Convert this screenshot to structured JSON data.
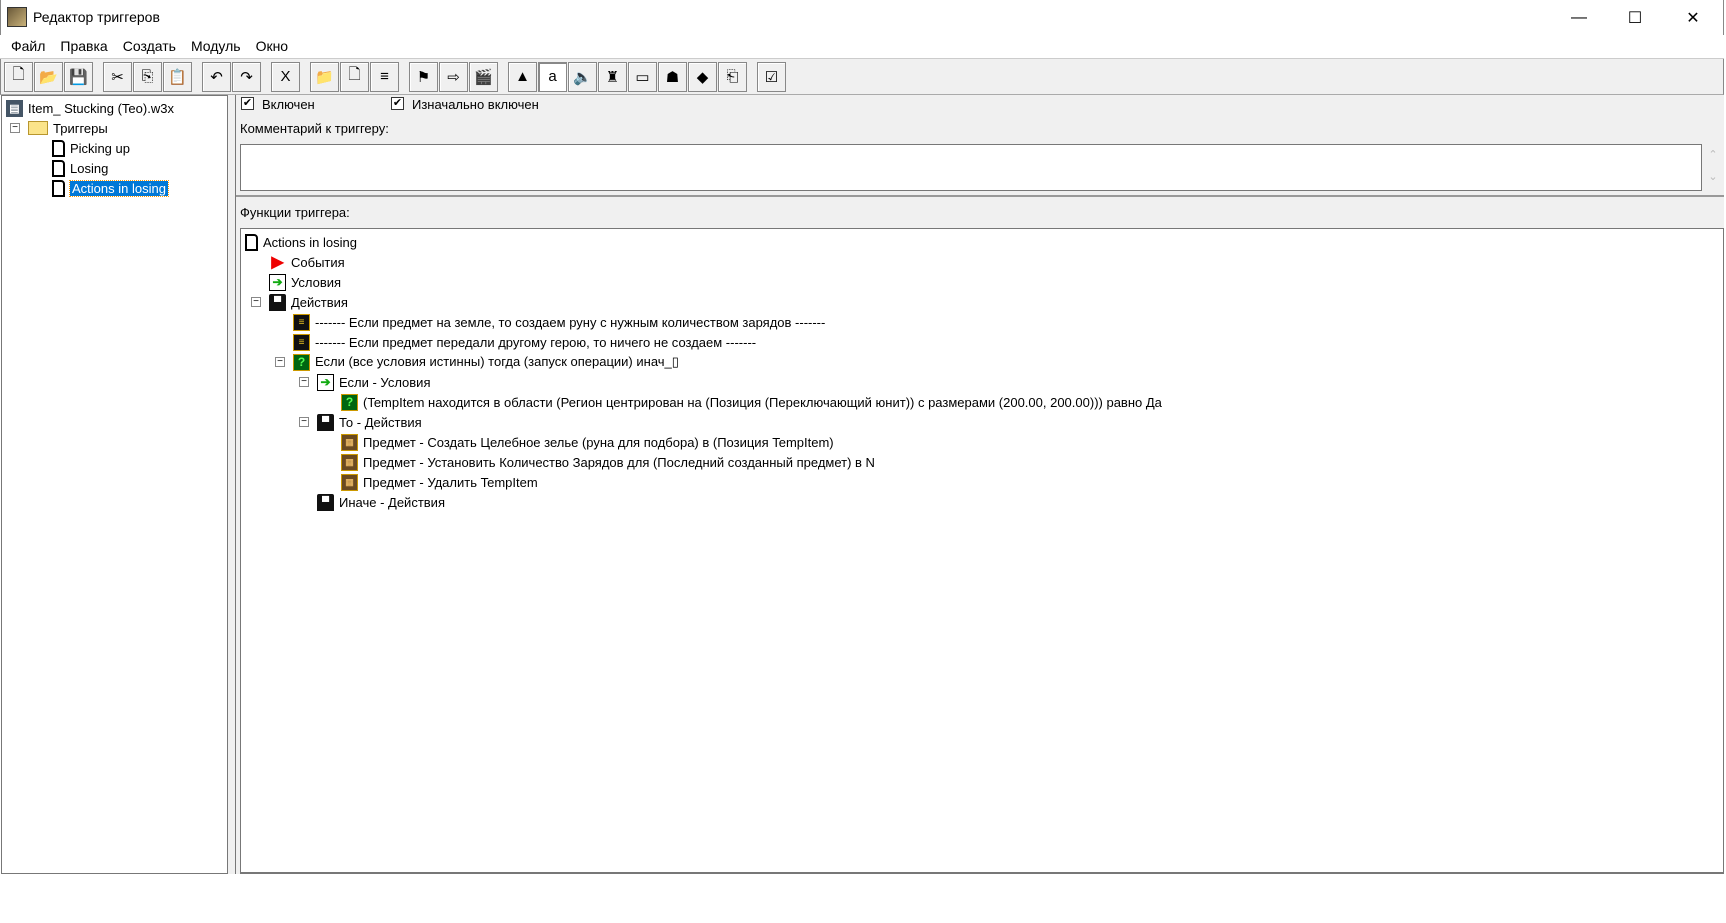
{
  "window": {
    "title": "Редактор триггеров",
    "minimize": "—",
    "maximize": "☐",
    "close": "✕"
  },
  "menu": [
    "Файл",
    "Правка",
    "Создать",
    "Модуль",
    "Окно"
  ],
  "toolbar": [
    {
      "name": "new",
      "glyph": "🗋"
    },
    {
      "name": "open",
      "glyph": "📂"
    },
    {
      "name": "save",
      "glyph": "💾"
    },
    null,
    {
      "name": "cut",
      "glyph": "✂"
    },
    {
      "name": "copy",
      "glyph": "⎘"
    },
    {
      "name": "paste",
      "glyph": "📋"
    },
    null,
    {
      "name": "undo",
      "glyph": "↶"
    },
    {
      "name": "redo",
      "glyph": "↷"
    },
    null,
    {
      "name": "delete",
      "glyph": "X"
    },
    null,
    {
      "name": "new-category",
      "glyph": "📁"
    },
    {
      "name": "new-trigger",
      "glyph": "🗋"
    },
    {
      "name": "new-comment",
      "glyph": "≡"
    },
    null,
    {
      "name": "new-event",
      "glyph": "⚑"
    },
    {
      "name": "new-condition",
      "glyph": "⇨"
    },
    {
      "name": "new-action",
      "glyph": "🎬"
    },
    null,
    {
      "name": "terrain-editor",
      "glyph": "▲"
    },
    {
      "name": "trigger-editor",
      "glyph": "a",
      "pressed": true
    },
    {
      "name": "sound-editor",
      "glyph": "🔈"
    },
    {
      "name": "object-editor",
      "glyph": "♜"
    },
    {
      "name": "campaign-editor",
      "glyph": "▭"
    },
    {
      "name": "ai-editor",
      "glyph": "☗"
    },
    {
      "name": "object-manager",
      "glyph": "◆"
    },
    {
      "name": "import-manager",
      "glyph": "⎗"
    },
    null,
    {
      "name": "test-map",
      "glyph": "☑"
    }
  ],
  "left_tree": {
    "map": "Item_ Stucking (Teo).w3x",
    "category": "Триггеры",
    "triggers": [
      "Picking up",
      "Losing",
      "Actions in losing"
    ],
    "selected": "Actions in losing"
  },
  "options": {
    "enabled": "Включен",
    "initially_on": "Изначально включен",
    "enabled_checked": true,
    "initially_on_checked": true
  },
  "comment": {
    "label": "Комментарий к триггеру:",
    "value": ""
  },
  "functions": {
    "label": "Функции триггера:",
    "rows": [
      {
        "depth": 0,
        "icon": "doc",
        "text": "Actions in losing"
      },
      {
        "depth": 1,
        "icon": "flag",
        "text": "События"
      },
      {
        "depth": 1,
        "icon": "cond",
        "text": "Условия"
      },
      {
        "depth": 1,
        "icon": "act",
        "text": "Действия",
        "expander": "−"
      },
      {
        "depth": 2,
        "icon": "comment",
        "text": "------- Если предмет на земле, то создаем руну с нужным количеством зарядов -------"
      },
      {
        "depth": 2,
        "icon": "comment",
        "text": "------- Если предмет передали другому герою, то ничего не создаем -------"
      },
      {
        "depth": 2,
        "icon": "if",
        "text": "Если (все условия истинны) тогда (запуск операции) инач_▯",
        "expander": "−"
      },
      {
        "depth": 3,
        "icon": "cond",
        "text": "Если - Условия",
        "expander": "−"
      },
      {
        "depth": 4,
        "icon": "if",
        "text": "(TempItem находится в области (Регион центрирован на (Позиция (Переключающий юнит)) с размерами (200.00, 200.00))) равно Да"
      },
      {
        "depth": 3,
        "icon": "act",
        "text": "То - Действия",
        "expander": "−"
      },
      {
        "depth": 4,
        "icon": "item",
        "text": "Предмет - Создать Целебное зелье (руна для подбора) в (Позиция TempItem)"
      },
      {
        "depth": 4,
        "icon": "item",
        "text": "Предмет - Установить Количество Зарядов для (Последний созданный предмет) в N"
      },
      {
        "depth": 4,
        "icon": "item",
        "text": "Предмет - Удалить TempItem"
      },
      {
        "depth": 3,
        "icon": "act",
        "text": "Иначе - Действия"
      }
    ]
  },
  "icon_glyphs": {
    "doc": "",
    "flag": "▶",
    "cond": "➔",
    "act": "▀",
    "comment": "≡",
    "if": "?",
    "item": "▦"
  }
}
